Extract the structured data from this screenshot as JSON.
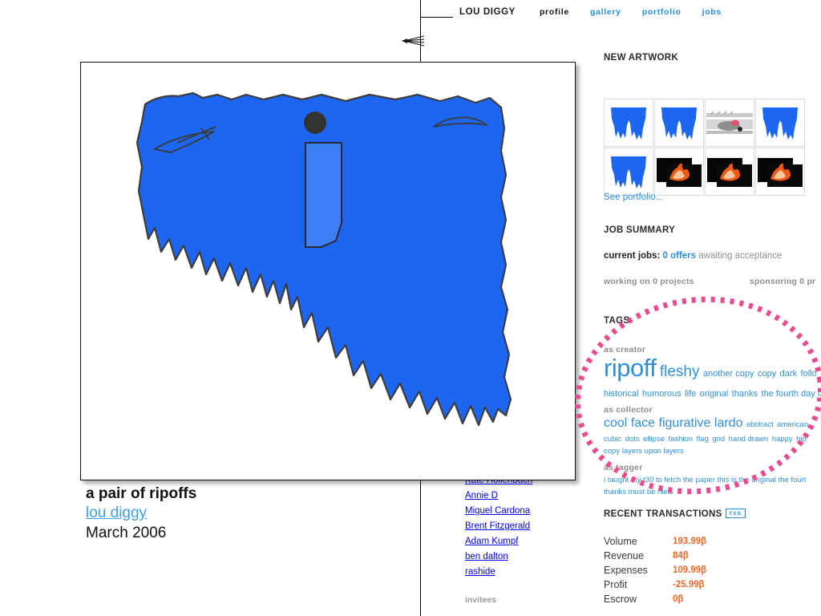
{
  "site": {
    "brand": "LOU DIGGY",
    "nav": [
      {
        "label": "profile",
        "style": "dark"
      },
      {
        "label": "gallery",
        "style": "blue"
      },
      {
        "label": "portfolio",
        "style": "blue"
      },
      {
        "label": "jobs",
        "style": "blue"
      }
    ],
    "cut_off_text": "o"
  },
  "new_artwork": {
    "heading": "NEW ARTWORK",
    "see_portfolio": "See portfolio...",
    "thumbs": [
      {
        "kind": "shorts"
      },
      {
        "kind": "shorts"
      },
      {
        "kind": "photo-gray"
      },
      {
        "kind": "shorts"
      },
      {
        "kind": "shorts"
      },
      {
        "kind": "flame"
      },
      {
        "kind": "flame"
      },
      {
        "kind": "flame"
      }
    ]
  },
  "job_summary": {
    "heading": "JOB SUMMARY",
    "current_jobs_label": "current jobs:",
    "offers": "0 offers",
    "awaiting": "awaiting acceptance",
    "working_on": "working on 0 projects",
    "sponsoring": "sponsoring 0 pr"
  },
  "tags": {
    "heading": "TAGS",
    "groups": [
      {
        "label": "as creator",
        "lines": [
          [
            {
              "text": "ripoff",
              "size": "t-xxl"
            },
            {
              "text": "fleshy",
              "size": "t-xl"
            },
            {
              "text": "another copy",
              "size": "t-md"
            },
            {
              "text": "copy",
              "size": "t-md"
            },
            {
              "text": "dark",
              "size": "t-md"
            },
            {
              "text": "follo",
              "size": "t-md"
            }
          ],
          [
            {
              "text": "historical",
              "size": "t-md"
            },
            {
              "text": "humorous",
              "size": "t-md"
            },
            {
              "text": "life",
              "size": "t-md"
            },
            {
              "text": "original",
              "size": "t-md"
            },
            {
              "text": "thanks",
              "size": "t-md"
            },
            {
              "text": "the fourth day of ma",
              "size": "t-md"
            }
          ]
        ]
      },
      {
        "label": "as collector",
        "lines": [
          [
            {
              "text": "cool",
              "size": "t-lg"
            },
            {
              "text": "face",
              "size": "t-lg"
            },
            {
              "text": "figurative",
              "size": "t-lg"
            },
            {
              "text": "lardo",
              "size": "t-lg"
            },
            {
              "text": "abstract",
              "size": "t-sm"
            },
            {
              "text": "american",
              "size": "t-sm"
            }
          ],
          [
            {
              "text": "cubic",
              "size": "t-sm"
            },
            {
              "text": "dots",
              "size": "t-sm"
            },
            {
              "text": "ellipse",
              "size": "t-sm"
            },
            {
              "text": "fashion",
              "size": "t-sm"
            },
            {
              "text": "flag",
              "size": "t-sm"
            },
            {
              "text": "grid",
              "size": "t-sm"
            },
            {
              "text": "hand drawn",
              "size": "t-sm"
            },
            {
              "text": "happy",
              "size": "t-sm"
            },
            {
              "text": "hip",
              "size": "t-sm"
            }
          ],
          [
            {
              "text": "copy layers upon layers",
              "size": "t-sm"
            }
          ]
        ]
      },
      {
        "label": "as tagger",
        "lines": [
          [
            {
              "text": "i taught my t30 to fetch the paper this is the original the fourt",
              "size": "t-sm"
            }
          ],
          [
            {
              "text": "thanks must be niels",
              "size": "t-sm"
            }
          ]
        ]
      }
    ]
  },
  "transactions": {
    "heading": "RECENT TRANSACTIONS",
    "rss_label": "rss",
    "rows": [
      {
        "label": "Volume",
        "value": "193.99β"
      },
      {
        "label": "Revenue",
        "value": "84β"
      },
      {
        "label": "Expenses",
        "value": "109.99β"
      },
      {
        "label": "Profit",
        "value": "-25.99β"
      },
      {
        "label": "Escrow",
        "value": "0β"
      }
    ]
  },
  "names": {
    "items": [
      "Kate Hollenbach",
      "Annie D",
      "Miguel Cardona",
      "Brent Fitzgerald",
      "Adam Kumpf",
      "ben dalton",
      "rashide"
    ],
    "footer": "invitees"
  },
  "artwork": {
    "title": "a pair of ripoffs",
    "author": "lou diggy",
    "date": "March 2006",
    "subject": "blue cutoff denim shorts"
  },
  "annotation": {
    "shape": "dotted-ellipse",
    "color": "#ea4b90",
    "target": "tags-section"
  },
  "colors": {
    "denim_blue": "#1c66f2",
    "denim_pocket": "#3d7ff5",
    "link_blue": "#2f8fdd",
    "orange": "#f06a28",
    "pink": "#ea4b90",
    "gray_label": "#8e8e8e"
  }
}
